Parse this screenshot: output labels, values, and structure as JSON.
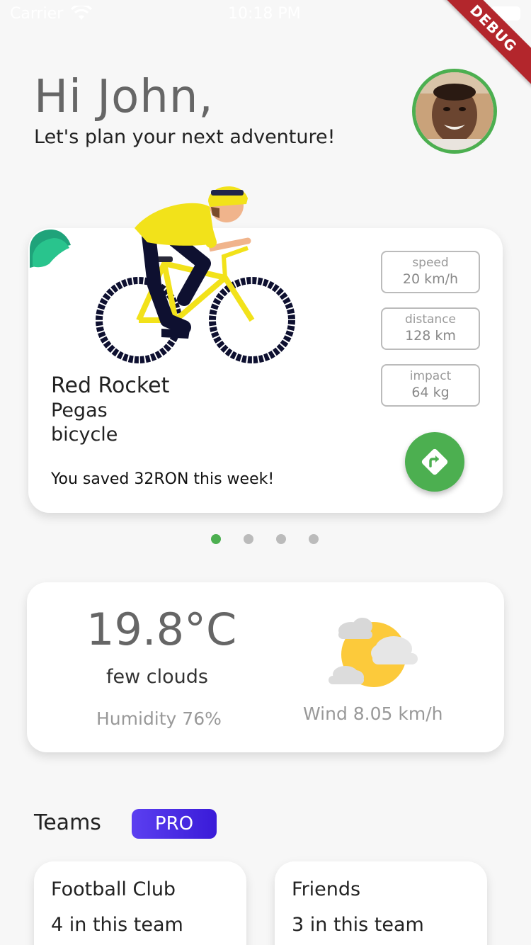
{
  "status_bar": {
    "carrier": "Carrier",
    "time": "10:18 PM"
  },
  "debug_banner": "DEBUG",
  "header": {
    "greeting": "Hi John,",
    "subtitle": "Let's plan your next adventure!"
  },
  "vehicle": {
    "name": "Red Rocket",
    "brand": "Pegas",
    "type": "bicycle",
    "saved_text": "You saved 32RON this week!",
    "stats": [
      {
        "label": "speed",
        "value": "20 km/h"
      },
      {
        "label": "distance",
        "value": "128 km"
      },
      {
        "label": "impact",
        "value": "64 kg"
      }
    ]
  },
  "carousel": {
    "total": 4,
    "active_index": 0,
    "active_color": "#4caf50",
    "inactive_color": "#bbbbbb"
  },
  "weather": {
    "temperature": "19.8°C",
    "condition": "few clouds",
    "humidity": "Humidity 76%",
    "wind": "Wind 8.05 km/h"
  },
  "teams": {
    "title": "Teams",
    "badge": "PRO",
    "items": [
      {
        "name": "Football Club",
        "count": "4 in this team"
      },
      {
        "name": "Friends",
        "count": "3 in this team"
      }
    ]
  },
  "colors": {
    "accent": "#4caf50",
    "pro_badge": "#4a2ee6",
    "background": "#f7f7f7"
  },
  "icons": {
    "wifi": "wifi-icon",
    "battery": "battery-icon",
    "directions": "directions-icon",
    "weather": "partly-cloudy-icon",
    "leaf": "leaf-icon"
  }
}
